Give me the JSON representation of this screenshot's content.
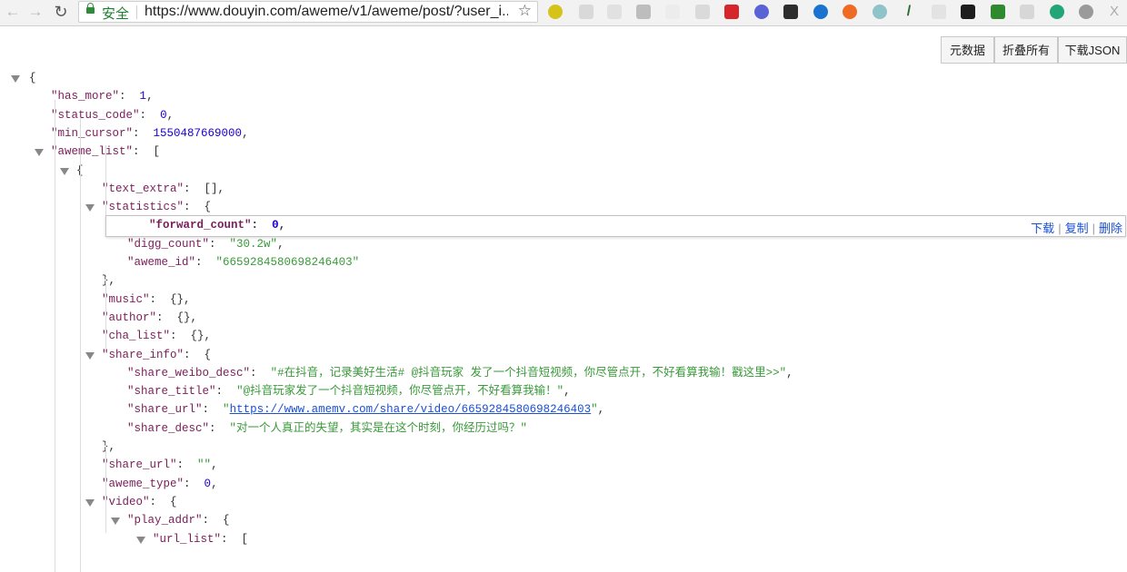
{
  "browser": {
    "secure_label": "安全",
    "url": "https://www.douyin.com/aweme/v1/aweme/post/?user_i..."
  },
  "actions": {
    "metadata": "元数据",
    "collapse_all": "折叠所有",
    "download_json": "下载JSON"
  },
  "row_actions": {
    "download": "下载",
    "copy": "复制",
    "delete": "删除"
  },
  "json_lines": [
    {
      "p": "{"
    },
    {
      "k": "\"has_more\"",
      "c": ":",
      "n": "1",
      "e": ","
    },
    {
      "k": "\"status_code\"",
      "c": ":",
      "n": "0",
      "e": ","
    },
    {
      "k": "\"min_cursor\"",
      "c": ":",
      "n": "1550487669000",
      "e": ","
    },
    {
      "k": "\"aweme_list\"",
      "c": ":",
      "p": "["
    },
    {
      "p": "{"
    },
    {
      "k": "\"text_extra\"",
      "c": ":",
      "p": "[],"
    },
    {
      "k": "\"statistics\"",
      "c": ":",
      "p": "{"
    },
    {
      "k": "\"forward_count\"",
      "c": ":",
      "n": "0",
      "e": ","
    },
    {
      "k": "\"digg_count\"",
      "c": ":",
      "s": "\"30.2w\"",
      "e": ","
    },
    {
      "k": "\"aweme_id\"",
      "c": ":",
      "s": "\"6659284580698246403\""
    },
    {
      "p": "},"
    },
    {
      "k": "\"music\"",
      "c": ":",
      "p": "{},"
    },
    {
      "k": "\"author\"",
      "c": ":",
      "p": "{},"
    },
    {
      "k": "\"cha_list\"",
      "c": ":",
      "p": "{},"
    },
    {
      "k": "\"share_info\"",
      "c": ":",
      "p": "{"
    },
    {
      "k": "\"share_weibo_desc\"",
      "c": ":",
      "s": "\"#在抖音，记录美好生活# @抖音玩家 发了一个抖音短视频，你尽管点开，不好看算我输！戳这里>>\"",
      "e": ","
    },
    {
      "k": "\"share_title\"",
      "c": ":",
      "s": "\"@抖音玩家发了一个抖音短视频，你尽管点开，不好看算我输！\"",
      "e": ","
    },
    {
      "k": "\"share_url\"",
      "c": ":",
      "q": "\"",
      "u": "https://www.amemv.com/share/video/6659284580698246403",
      "q2": "\"",
      "e": ","
    },
    {
      "k": "\"share_desc\"",
      "c": ":",
      "s": "\"对一个人真正的失望，其实是在这个时刻，你经历过吗？\""
    },
    {
      "p": "},"
    },
    {
      "k": "\"share_url\"",
      "c": ":",
      "s": "\"\"",
      "e": ","
    },
    {
      "k": "\"aweme_type\"",
      "c": ":",
      "n": "0",
      "e": ","
    },
    {
      "k": "\"video\"",
      "c": ":",
      "p": "{"
    },
    {
      "k": "\"play_addr\"",
      "c": ":",
      "p": "{"
    },
    {
      "k": "\"url_list\"",
      "c": ":",
      "p": "["
    }
  ],
  "colors": {
    "key": "#7a1e58",
    "number": "#1c00cf",
    "string": "#3a9a3a",
    "link": "#1a4fd6"
  }
}
